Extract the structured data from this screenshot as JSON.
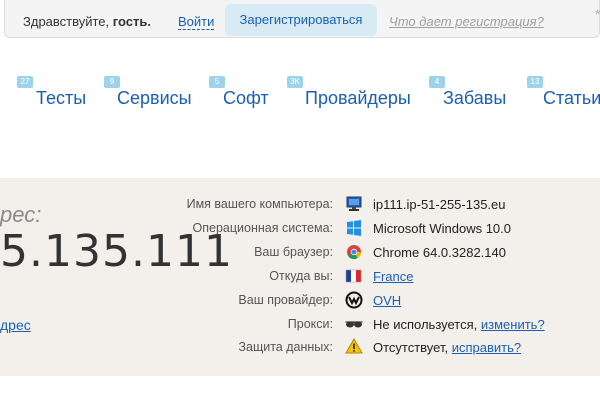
{
  "topbar": {
    "greeting": "Здравствуйте,",
    "guest": "гость.",
    "login": "Войти",
    "register": "Зарегистрироваться",
    "what_registration": "Что дает регистрация?"
  },
  "nav": [
    {
      "label": "Тесты",
      "badge": "27"
    },
    {
      "label": "Сервисы",
      "badge": "9"
    },
    {
      "label": "Софт",
      "badge": "5"
    },
    {
      "label": "Провайдеры",
      "badge": "3K"
    },
    {
      "label": "Забавы",
      "badge": "4"
    },
    {
      "label": "Статьи",
      "badge": "13"
    }
  ],
  "ip": {
    "label": "рес:",
    "value": "5.135.111",
    "link": "дрес"
  },
  "info": {
    "computer": {
      "label": "Имя вашего компьютера:",
      "value": "ip111.ip-51-255-135.eu",
      "icon": "monitor-icon"
    },
    "os": {
      "label": "Операционная система:",
      "value": "Microsoft Windows 10.0",
      "icon": "windows-icon"
    },
    "browser": {
      "label": "Ваш браузер:",
      "value": "Chrome 64.0.3282.140",
      "icon": "chrome-icon"
    },
    "country": {
      "label": "Откуда вы:",
      "value": "France",
      "icon": "france-flag-icon"
    },
    "provider": {
      "label": "Ваш провайдер:",
      "value": "OVH",
      "icon": "ovh-icon"
    },
    "proxy": {
      "label": "Прокси:",
      "value": "Не используется,",
      "link": "изменить?",
      "icon": "glasses-icon"
    },
    "protection": {
      "label": "Защита данных:",
      "value": "Отсутствует,",
      "link": "исправить?",
      "icon": "warning-icon"
    }
  },
  "colors": {
    "link": "#1a5fb4",
    "badge": "#9dd3ea",
    "panel": "#f3f0ec"
  }
}
